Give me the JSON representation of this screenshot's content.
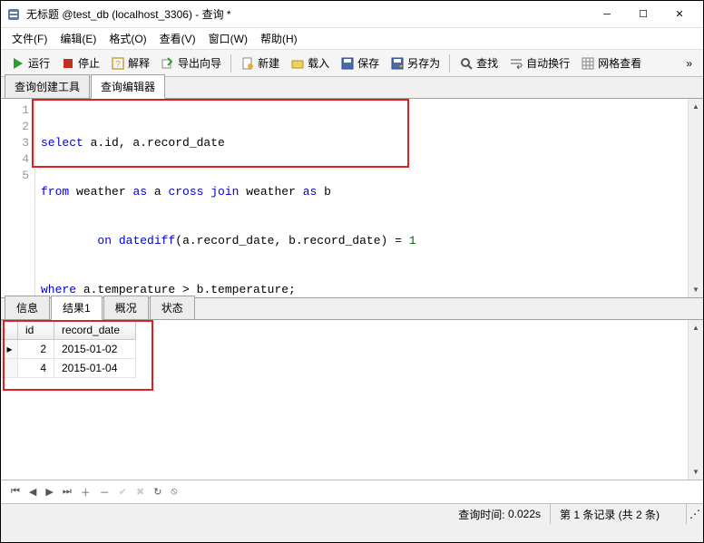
{
  "window": {
    "title": "无标题 @test_db (localhost_3306) - 查询 *"
  },
  "menu": {
    "file": "文件(F)",
    "edit": "编辑(E)",
    "format": "格式(O)",
    "view": "查看(V)",
    "window": "窗口(W)",
    "help": "帮助(H)"
  },
  "toolbar": {
    "run": "运行",
    "stop": "停止",
    "explain": "解释",
    "export": "导出向导",
    "new": "新建",
    "load": "载入",
    "save": "保存",
    "saveas": "另存为",
    "find": "查找",
    "wrap": "自动换行",
    "gridview": "网格查看"
  },
  "editor_tabs": {
    "builder": "查询创建工具",
    "editor": "查询编辑器"
  },
  "sql": {
    "l1": {
      "kw1": "select",
      "rest": " a.id, a.record_date"
    },
    "l2": {
      "kw1": "from",
      "t1": " weather ",
      "kw2": "as",
      "a1": " a ",
      "kw3": "cross join",
      "t2": " weather ",
      "kw4": "as",
      "a2": " b"
    },
    "l3": {
      "pad": "        ",
      "kw1": "on",
      "sp": " ",
      "fn": "datediff",
      "args": "(a.record_date, b.record_date) = ",
      "num": "1"
    },
    "l4": {
      "kw1": "where",
      "rest": " a.temperature > b.temperature;"
    }
  },
  "result_tabs": {
    "info": "信息",
    "result1": "结果1",
    "profile": "概况",
    "status": "状态"
  },
  "result": {
    "columns": {
      "id": "id",
      "record_date": "record_date"
    },
    "rows": [
      {
        "id": "2",
        "record_date": "2015-01-02"
      },
      {
        "id": "4",
        "record_date": "2015-01-04"
      }
    ]
  },
  "status": {
    "query_time_label": "查询时间:",
    "query_time_value": "0.022s",
    "record_info": "第 1 条记录 (共 2 条)"
  }
}
